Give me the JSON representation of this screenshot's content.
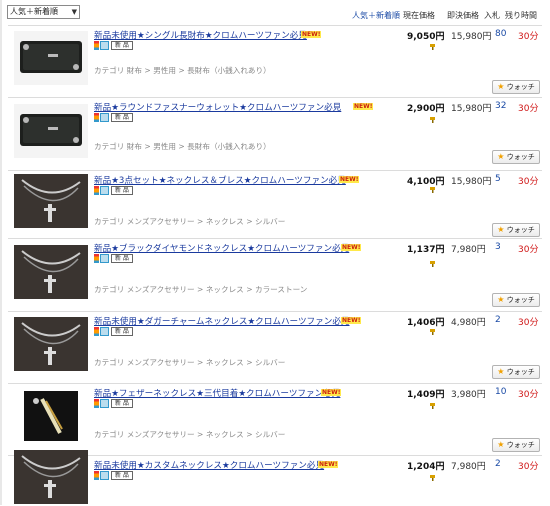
{
  "sort": {
    "selected": "人気＋新着順"
  },
  "headers": {
    "popular_new": "人気＋新着順",
    "current_price": "現在価格",
    "buy_now_price": "即決価格",
    "bids": "入札",
    "time_left": "残り時間"
  },
  "labels": {
    "new_badge": "NEW!",
    "condition_tag": "新 品",
    "watch": "ウォッチ",
    "category_prefix": "カテゴリ"
  },
  "items": [
    {
      "title": "新品未使用★シングル長財布★クロムハーツファン必見",
      "category": [
        "財布",
        "男性用",
        "長財布（小銭入れあり）"
      ],
      "price": "9,050円",
      "buy_now": "15,980円",
      "bids": "80",
      "time_left": "30分",
      "thumb": "wallet"
    },
    {
      "title": "新品★ラウンドファスナーウォレット★クロムハーツファン必見",
      "category": [
        "財布",
        "男性用",
        "長財布（小銭入れあり）"
      ],
      "price": "2,900円",
      "buy_now": "15,980円",
      "bids": "32",
      "time_left": "30分",
      "thumb": "wallet"
    },
    {
      "title": "新品★3点セット★ネックレス＆ブレス★クロムハーツファン必見",
      "category": [
        "メンズアクセサリー",
        "ネックレス",
        "シルバー"
      ],
      "price": "4,100円",
      "buy_now": "15,980円",
      "bids": "5",
      "time_left": "30分",
      "thumb": "chain"
    },
    {
      "title": "新品★ブラックダイヤモンドネックレス★クロムハーツファン必見",
      "category": [
        "メンズアクセサリー",
        "ネックレス",
        "カラーストーン"
      ],
      "price": "1,137円",
      "buy_now": "7,980円",
      "bids": "3",
      "time_left": "30分",
      "thumb": "chain"
    },
    {
      "title": "新品未使用★ダガーチャームネックレス★クロムハーツファン必見",
      "category": [
        "メンズアクセサリー",
        "ネックレス",
        "シルバー"
      ],
      "price": "1,406円",
      "buy_now": "4,980円",
      "bids": "2",
      "time_left": "30分",
      "thumb": "chain"
    },
    {
      "title": "新品★フェザーネックレス★三代目着★クロムハーツファン必見",
      "category": [
        "メンズアクセサリー",
        "ネックレス",
        "シルバー"
      ],
      "price": "1,409円",
      "buy_now": "3,980円",
      "bids": "10",
      "time_left": "30分",
      "thumb": "feather"
    },
    {
      "title": "新品未使用★カスタムネックレス★クロムハーツファン必見",
      "category": [],
      "price": "1,204円",
      "buy_now": "7,980円",
      "bids": "2",
      "time_left": "30分",
      "thumb": "chain"
    }
  ]
}
